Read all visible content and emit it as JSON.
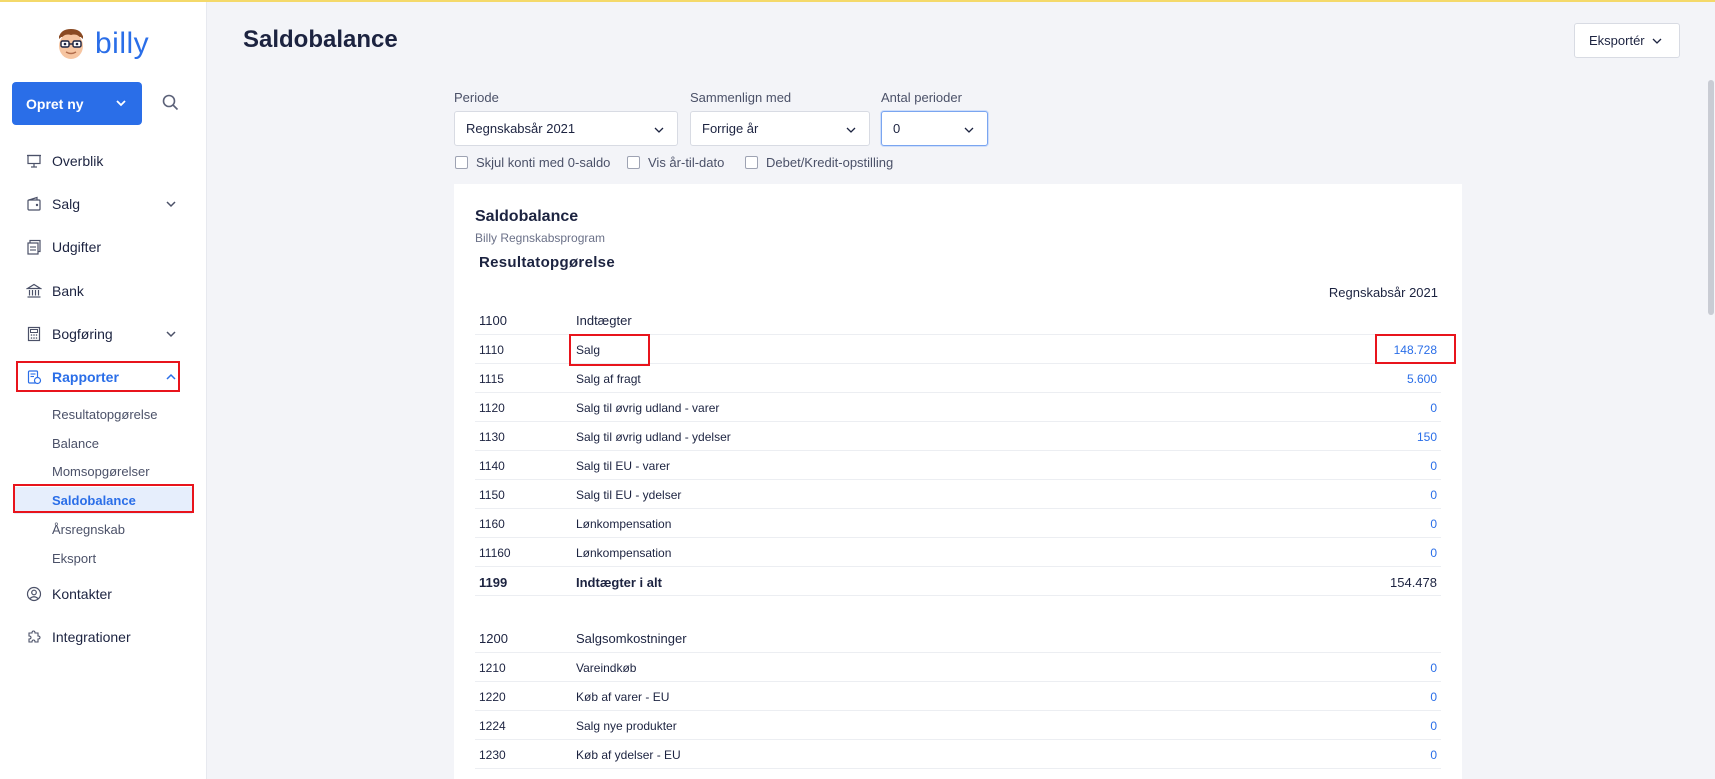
{
  "app": {
    "logo_text": "billy"
  },
  "sidebar": {
    "create_label": "Opret ny",
    "items": [
      {
        "label": "Overblik",
        "icon": "presentation-icon"
      },
      {
        "label": "Salg",
        "icon": "wallet-icon"
      },
      {
        "label": "Udgifter",
        "icon": "receipt-icon"
      },
      {
        "label": "Bank",
        "icon": "bank-icon"
      },
      {
        "label": "Bogføring",
        "icon": "calculator-icon"
      },
      {
        "label": "Rapporter",
        "icon": "report-icon"
      },
      {
        "label": "Kontakter",
        "icon": "user-circle-icon"
      },
      {
        "label": "Integrationer",
        "icon": "puzzle-icon"
      }
    ],
    "report_sub": [
      "Resultatopgørelse",
      "Balance",
      "Momsopgørelser",
      "Saldobalance",
      "Årsregnskab",
      "Eksport"
    ]
  },
  "header": {
    "title": "Saldobalance",
    "export_label": "Eksportér"
  },
  "filters": {
    "period_label": "Periode",
    "period_value": "Regnskabsår 2021",
    "compare_label": "Sammenlign med",
    "compare_value": "Forrige år",
    "count_label": "Antal perioder",
    "count_value": "0",
    "cb_zero": "Skjul konti med 0-saldo",
    "cb_ytd": "Vis år-til-dato",
    "cb_debit": "Debet/Kredit-opstilling"
  },
  "report": {
    "title": "Saldobalance",
    "subtitle": "Billy Regnskabsprogram",
    "section": "Resultatopgørelse",
    "column": "Regnskabsår 2021",
    "rows": [
      {
        "num": "1100",
        "name": "Indtægter",
        "value": ""
      },
      {
        "num": "1110",
        "name": "Salg",
        "value": "148.728"
      },
      {
        "num": "1115",
        "name": "Salg af fragt",
        "value": "5.600"
      },
      {
        "num": "1120",
        "name": "Salg til øvrig udland - varer",
        "value": "0"
      },
      {
        "num": "1130",
        "name": "Salg til øvrig udland - ydelser",
        "value": "150"
      },
      {
        "num": "1140",
        "name": "Salg til EU - varer",
        "value": "0"
      },
      {
        "num": "1150",
        "name": "Salg til EU - ydelser",
        "value": "0"
      },
      {
        "num": "1160",
        "name": "Lønkompensation",
        "value": "0"
      },
      {
        "num": "11160",
        "name": "Lønkompensation",
        "value": "0"
      },
      {
        "num": "1199",
        "name": "Indtægter i alt",
        "value": "154.478"
      },
      {
        "num": "1200",
        "name": "Salgsomkostninger",
        "value": ""
      },
      {
        "num": "1210",
        "name": "Vareindkøb",
        "value": "0"
      },
      {
        "num": "1220",
        "name": "Køb af varer - EU",
        "value": "0"
      },
      {
        "num": "1224",
        "name": "Salg nye produkter",
        "value": "0"
      },
      {
        "num": "1230",
        "name": "Køb af ydelser - EU",
        "value": "0"
      }
    ]
  }
}
